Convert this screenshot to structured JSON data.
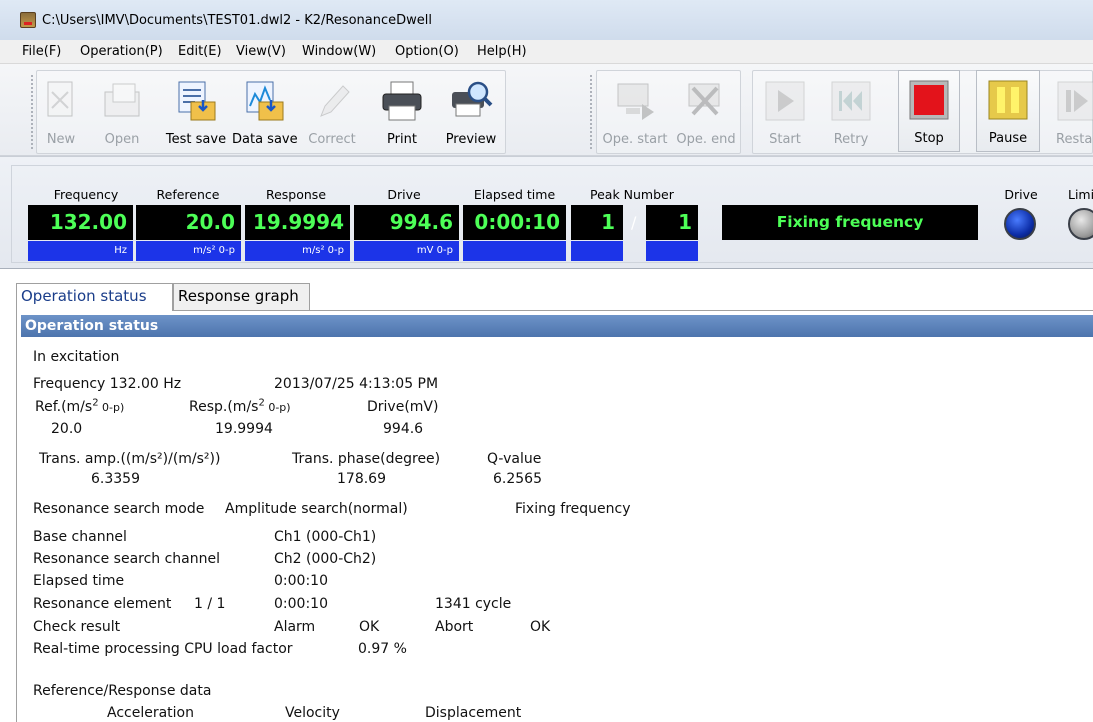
{
  "window": {
    "title": "C:\\Users\\IMV\\Documents\\TEST01.dwl2 - K2/ResonanceDwell"
  },
  "menu": [
    "File(F)",
    "Operation(P)",
    "Edit(E)",
    "View(V)",
    "Window(W)",
    "Option(O)",
    "Help(H)"
  ],
  "toolbar": {
    "new": "New",
    "open": "Open",
    "test_save": "Test save",
    "data_save": "Data save",
    "correct": "Correct",
    "print": "Print",
    "preview": "Preview",
    "ope_start": "Ope. start",
    "ope_end": "Ope. end",
    "start": "Start",
    "retry": "Retry",
    "stop": "Stop",
    "pause": "Pause",
    "restart": "Restar"
  },
  "monitor": {
    "frequency": {
      "caption": "Frequency",
      "value": "132.00",
      "unit": "Hz"
    },
    "reference": {
      "caption": "Reference",
      "value": "20.0",
      "unit": "m/s² 0-p"
    },
    "response": {
      "caption": "Response",
      "value": "19.9994",
      "unit": "m/s² 0-p"
    },
    "drive": {
      "caption": "Drive",
      "value": "994.6",
      "unit": "mV 0-p"
    },
    "elapsed": {
      "caption": "Elapsed time",
      "value": "0:00:10",
      "unit": ""
    },
    "peak": {
      "caption": "Peak Number",
      "current": "1",
      "separator": "/",
      "total": "1"
    },
    "status": "Fixing frequency",
    "drive_led": "Drive",
    "limit_led": "Limi"
  },
  "tabs": [
    "Operation status",
    "Response graph"
  ],
  "status": {
    "header": "Operation status",
    "state": "In excitation",
    "frequency_line": "Frequency 132.00 Hz",
    "datetime": "2013/07/25 4:13:05 PM",
    "ref_label_a": "Ref.(m/s",
    "ref_label_b": " 0-p)",
    "resp_label_a": "Resp.(m/s",
    "resp_label_b": " 0-p)",
    "drive_label": "Drive(mV)",
    "ref_value": "20.0",
    "resp_value": "19.9994",
    "drive_value": "994.6",
    "trans_amp_label": "Trans. amp.((m/s²)/(m/s²))",
    "trans_phase_label": "Trans. phase(degree)",
    "q_label": "Q-value",
    "trans_amp_value": "6.3359",
    "trans_phase_value": "178.69",
    "q_value": "6.2565",
    "search_mode_label": "Resonance search mode",
    "search_mode_value": "Amplitude search(normal)",
    "search_state": "Fixing frequency",
    "base_channel_label": "Base channel",
    "base_channel_value": "Ch1 (000-Ch1)",
    "search_channel_label": "Resonance search channel",
    "search_channel_value": "Ch2 (000-Ch2)",
    "elapsed_label": "Elapsed time",
    "elapsed_value": "0:00:10",
    "element_label": "Resonance element",
    "element_count": "1 / 1",
    "element_time": "0:00:10",
    "element_cycles": "1341 cycle",
    "check_label": "Check result",
    "alarm_label": "Alarm",
    "alarm_value": "OK",
    "abort_label": "Abort",
    "abort_value": "OK",
    "cpu_label": "Real-time processing CPU load factor",
    "cpu_value": "0.97 %",
    "refresp_label": "Reference/Response data",
    "col_accel": "Acceleration",
    "col_velocity": "Velocity",
    "col_disp": "Displacement"
  }
}
